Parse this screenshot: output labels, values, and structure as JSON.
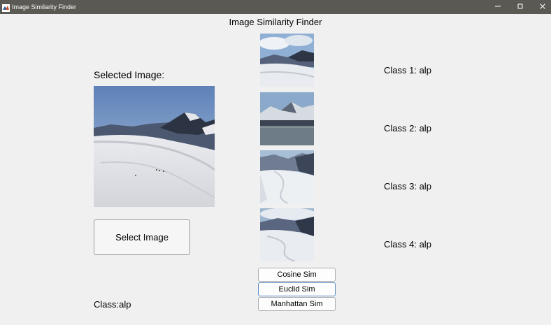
{
  "window": {
    "title": "Image Similarity Finder",
    "icon": "matlab-icon",
    "controls": [
      "minimize-icon",
      "maximize-icon",
      "close-icon"
    ]
  },
  "header": {
    "title": "Image Similarity Finder"
  },
  "query": {
    "label": "Selected Image:",
    "select_button": "Select Image",
    "class_result": "Class:alp"
  },
  "results": [
    {
      "label": "Class 1: alp"
    },
    {
      "label": "Class 2: alp"
    },
    {
      "label": "Class 3: alp"
    },
    {
      "label": "Class 4: alp"
    }
  ],
  "metrics": {
    "cosine": "Cosine Sim",
    "euclid": "Euclid Sim",
    "manhattan": "Manhattan Sim"
  },
  "colors": {
    "titlebar": "#5b5953",
    "background": "#f0f0f0",
    "focus_border": "#5b8fc6"
  }
}
